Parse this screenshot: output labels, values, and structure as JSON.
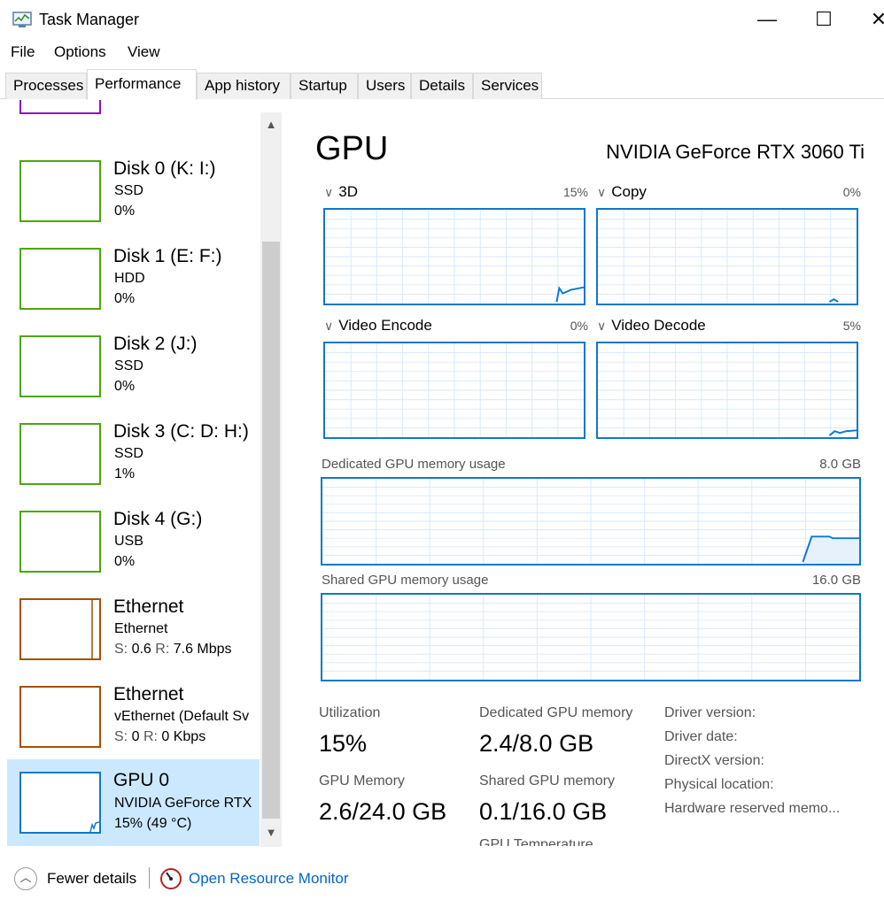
{
  "window": {
    "title": "Task Manager",
    "minimize": "—",
    "maximize": "☐",
    "close": "✕"
  },
  "menu": [
    "File",
    "Options",
    "View"
  ],
  "tabs": [
    "Processes",
    "Performance",
    "App history",
    "Startup",
    "Users",
    "Details",
    "Services"
  ],
  "active_tab": "Performance",
  "sidebar": {
    "items": [
      {
        "name": "Disk 0 (K: I:)",
        "sub1": "SSD",
        "sub2": "0%"
      },
      {
        "name": "Disk 1 (E: F:)",
        "sub1": "HDD",
        "sub2": "0%"
      },
      {
        "name": "Disk 2 (J:)",
        "sub1": "SSD",
        "sub2": "0%"
      },
      {
        "name": "Disk 3 (C: D: H:)",
        "sub1": "SSD",
        "sub2": "1%"
      },
      {
        "name": "Disk 4 (G:)",
        "sub1": "USB",
        "sub2": "0%"
      },
      {
        "name": "Ethernet",
        "sub1": "Ethernet",
        "send_label": "S:",
        "send": "0.6",
        "recv_label": "R:",
        "recv": "7.6 Mbps"
      },
      {
        "name": "Ethernet",
        "sub1": "vEthernet (Default Sv",
        "send_label": "S:",
        "send": "0",
        "recv_label": "R:",
        "recv": "0 Kbps"
      },
      {
        "name": "GPU 0",
        "sub1": "NVIDIA GeForce RTX",
        "sub2": "15% (49 °C)"
      }
    ]
  },
  "gpu": {
    "title": "GPU",
    "model": "NVIDIA GeForce RTX 3060 Ti",
    "engines": [
      {
        "label": "3D",
        "percent": "15%"
      },
      {
        "label": "Copy",
        "percent": "0%"
      },
      {
        "label": "Video Encode",
        "percent": "0%"
      },
      {
        "label": "Video Decode",
        "percent": "5%"
      }
    ],
    "dedicated_memory": {
      "label": "Dedicated GPU memory usage",
      "max": "8.0 GB"
    },
    "shared_memory": {
      "label": "Shared GPU memory usage",
      "max": "16.0 GB"
    },
    "stats": {
      "utilization_label": "Utilization",
      "utilization": "15%",
      "dedicated_label": "Dedicated GPU memory",
      "dedicated": "2.4/8.0 GB",
      "gpu_memory_label": "GPU Memory",
      "gpu_memory": "2.6/24.0 GB",
      "shared_label": "Shared GPU memory",
      "shared": "0.1/16.0 GB"
    },
    "info": [
      "Driver version:",
      "Driver date:",
      "DirectX version:",
      "Physical location:",
      "Hardware reserved memo..."
    ]
  },
  "footer": {
    "fewer_details": "Fewer details",
    "open_resource_monitor": "Open Resource Monitor"
  },
  "colors": {
    "graph_blue": "#1178c8",
    "disk_green": "#4da60c",
    "ethernet_orange": "#a74f01",
    "selected_bg": "#cce8ff",
    "link": "#0066cc"
  }
}
